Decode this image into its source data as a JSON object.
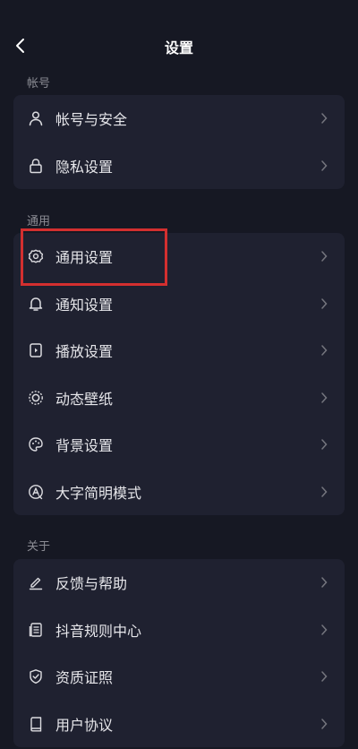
{
  "header": {
    "title": "设置"
  },
  "sections": [
    {
      "label": "帐号",
      "items": [
        {
          "label": "帐号与安全",
          "icon": "user-icon"
        },
        {
          "label": "隐私设置",
          "icon": "lock-icon"
        }
      ]
    },
    {
      "label": "通用",
      "items": [
        {
          "label": "通用设置",
          "icon": "gear-icon"
        },
        {
          "label": "通知设置",
          "icon": "bell-icon"
        },
        {
          "label": "播放设置",
          "icon": "play-settings-icon"
        },
        {
          "label": "动态壁纸",
          "icon": "live-wallpaper-icon"
        },
        {
          "label": "背景设置",
          "icon": "palette-icon"
        },
        {
          "label": "大字简明模式",
          "icon": "large-text-icon"
        }
      ]
    },
    {
      "label": "关于",
      "items": [
        {
          "label": "反馈与帮助",
          "icon": "edit-icon"
        },
        {
          "label": "抖音规则中心",
          "icon": "document-icon"
        },
        {
          "label": "资质证照",
          "icon": "shield-check-icon"
        },
        {
          "label": "用户协议",
          "icon": "book-icon"
        }
      ]
    }
  ],
  "colors": {
    "background": "#161823",
    "card": "#1f2130",
    "highlight": "#d32f2f"
  }
}
